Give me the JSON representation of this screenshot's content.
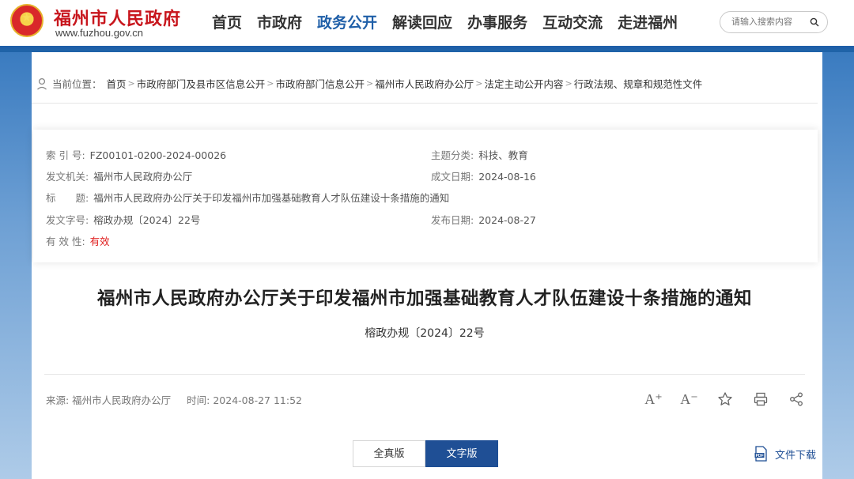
{
  "header": {
    "site_name": "福州市人民政府",
    "site_url": "www.fuzhou.gov.cn",
    "nav": [
      "首页",
      "市政府",
      "政务公开",
      "解读回应",
      "办事服务",
      "互动交流",
      "走进福州"
    ],
    "active_nav_index": 2,
    "search_placeholder": "请输入搜索内容"
  },
  "breadcrumb": {
    "label": "当前位置：",
    "items": [
      "首页",
      "市政府部门及县市区信息公开",
      "市政府部门信息公开",
      "福州市人民政府办公厅",
      "法定主动公开内容",
      "行政法规、规章和规范性文件"
    ]
  },
  "meta": {
    "index_key": "索 引 号:",
    "index_val": "FZ00101-0200-2024-00026",
    "topic_key": "主题分类:",
    "topic_val": "科技、教育",
    "issuer_key": "发文机关:",
    "issuer_val": "福州市人民政府办公厅",
    "date_key": "成文日期:",
    "date_val": "2024-08-16",
    "title_key": "标　　题:",
    "title_val": "福州市人民政府办公厅关于印发福州市加强基础教育人才队伍建设十条措施的通知",
    "docno_key": "发文字号:",
    "docno_val": "榕政办规〔2024〕22号",
    "pub_key": "发布日期:",
    "pub_val": "2024-08-27",
    "valid_key": "有 效 性:",
    "valid_val": "有效"
  },
  "article": {
    "title": "福州市人民政府办公厅关于印发福州市加强基础教育人才队伍建设十条措施的通知",
    "doc_number": "榕政办规〔2024〕22号",
    "source": "来源:  福州市人民政府办公厅",
    "time": "时间:  2024-08-27 11:52",
    "tools": [
      "font-increase-icon",
      "font-decrease-icon",
      "star-icon",
      "print-icon",
      "share-icon"
    ],
    "font_increase": "A⁺",
    "font_decrease": "A⁻"
  },
  "versions": {
    "full": "全真版",
    "text": "文字版",
    "active": "text"
  },
  "download": {
    "label": "文件下载"
  },
  "colors": {
    "brand_red": "#c8161d",
    "brand_blue": "#1f5fa8",
    "valid_red": "#e02020"
  }
}
